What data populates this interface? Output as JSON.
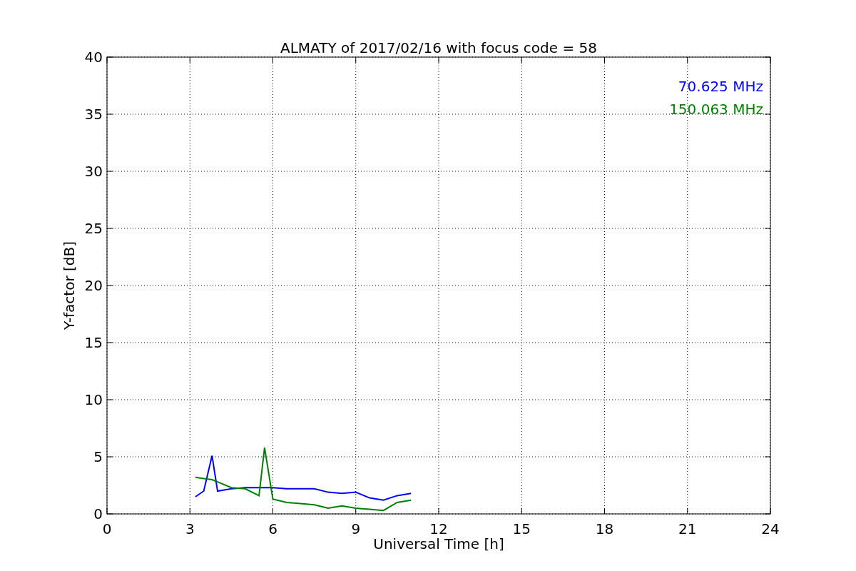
{
  "chart_data": {
    "type": "line",
    "title": "ALMATY of 2017/02/16 with focus code = 58",
    "xlabel": "Universal Time [h]",
    "ylabel": "Y-factor [dB]",
    "x": [
      3.2,
      3.5,
      3.8,
      4,
      4.5,
      5,
      5.5,
      5.7,
      6,
      6.5,
      7,
      7.5,
      8,
      8.5,
      9,
      9.5,
      10,
      10.5,
      11
    ],
    "series": [
      {
        "name": "70.625 MHz",
        "color": "#0000ff",
        "values": [
          1.5,
          2.0,
          5.1,
          2.0,
          2.2,
          2.3,
          2.3,
          2.3,
          2.3,
          2.2,
          2.2,
          2.2,
          1.9,
          1.8,
          1.9,
          1.4,
          1.2,
          1.6,
          1.8
        ]
      },
      {
        "name": "150.063 MHz",
        "color": "#008000",
        "values": [
          3.2,
          3.1,
          3.0,
          2.8,
          2.3,
          2.2,
          1.6,
          5.8,
          1.3,
          1.0,
          0.9,
          0.8,
          0.5,
          0.7,
          0.5,
          0.4,
          0.3,
          1.0,
          1.2
        ]
      }
    ],
    "grid": true,
    "xlim": [
      0,
      24
    ],
    "ylim": [
      0,
      40
    ],
    "xticks": [
      0,
      3,
      6,
      9,
      12,
      15,
      18,
      21,
      24
    ],
    "yticks": [
      0,
      5,
      10,
      15,
      20,
      25,
      30,
      35,
      40
    ]
  }
}
